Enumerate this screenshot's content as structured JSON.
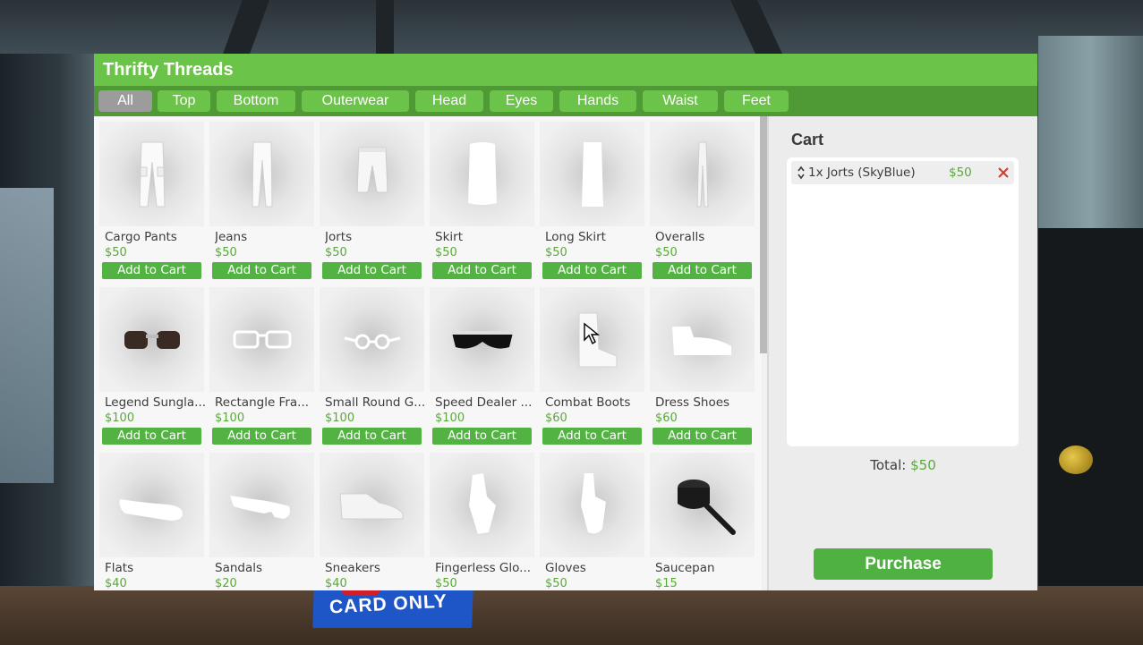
{
  "background": {
    "sign_text": "CARD ONLY"
  },
  "shop": {
    "title": "Thrifty Threads",
    "colors": {
      "header": "#6cc34a",
      "tabbar": "#4f9a34",
      "tab_active": "#9c9c9c",
      "button": "#52b342",
      "price": "#5aa83a",
      "remove": "#d23a2a"
    },
    "tabs": [
      {
        "label": "All",
        "active": true
      },
      {
        "label": "Top",
        "active": false
      },
      {
        "label": "Bottom",
        "active": false
      },
      {
        "label": "Outerwear",
        "active": false
      },
      {
        "label": "Head",
        "active": false
      },
      {
        "label": "Eyes",
        "active": false
      },
      {
        "label": "Hands",
        "active": false
      },
      {
        "label": "Waist",
        "active": false
      },
      {
        "label": "Feet",
        "active": false
      }
    ],
    "add_to_cart_label": "Add to Cart",
    "items": [
      {
        "name": "Cargo Pants",
        "price": "$50",
        "icon": "cargo-pants-icon"
      },
      {
        "name": "Jeans",
        "price": "$50",
        "icon": "jeans-icon"
      },
      {
        "name": "Jorts",
        "price": "$50",
        "icon": "jorts-icon"
      },
      {
        "name": "Skirt",
        "price": "$50",
        "icon": "skirt-icon"
      },
      {
        "name": "Long Skirt",
        "price": "$50",
        "icon": "long-skirt-icon"
      },
      {
        "name": "Overalls",
        "price": "$50",
        "icon": "overalls-icon"
      },
      {
        "name": "Legend Sungla...",
        "price": "$100",
        "icon": "legend-sunglasses-icon"
      },
      {
        "name": "Rectangle Fra...",
        "price": "$100",
        "icon": "rectangle-frames-icon"
      },
      {
        "name": "Small Round G...",
        "price": "$100",
        "icon": "small-round-glasses-icon"
      },
      {
        "name": "Speed Dealer ...",
        "price": "$100",
        "icon": "speed-dealer-glasses-icon"
      },
      {
        "name": "Combat Boots",
        "price": "$60",
        "icon": "combat-boots-icon"
      },
      {
        "name": "Dress Shoes",
        "price": "$60",
        "icon": "dress-shoes-icon"
      },
      {
        "name": "Flats",
        "price": "$40",
        "icon": "flats-icon"
      },
      {
        "name": "Sandals",
        "price": "$20",
        "icon": "sandals-icon"
      },
      {
        "name": "Sneakers",
        "price": "$40",
        "icon": "sneakers-icon"
      },
      {
        "name": "Fingerless Glo...",
        "price": "$50",
        "icon": "fingerless-gloves-icon"
      },
      {
        "name": "Gloves",
        "price": "$50",
        "icon": "gloves-icon"
      },
      {
        "name": "Saucepan",
        "price": "$15",
        "icon": "saucepan-icon"
      }
    ]
  },
  "cart": {
    "title": "Cart",
    "items": [
      {
        "label": "1x Jorts (SkyBlue)",
        "price": "$50"
      }
    ],
    "total_label": "Total:",
    "total_value": "$50",
    "purchase_label": "Purchase"
  }
}
